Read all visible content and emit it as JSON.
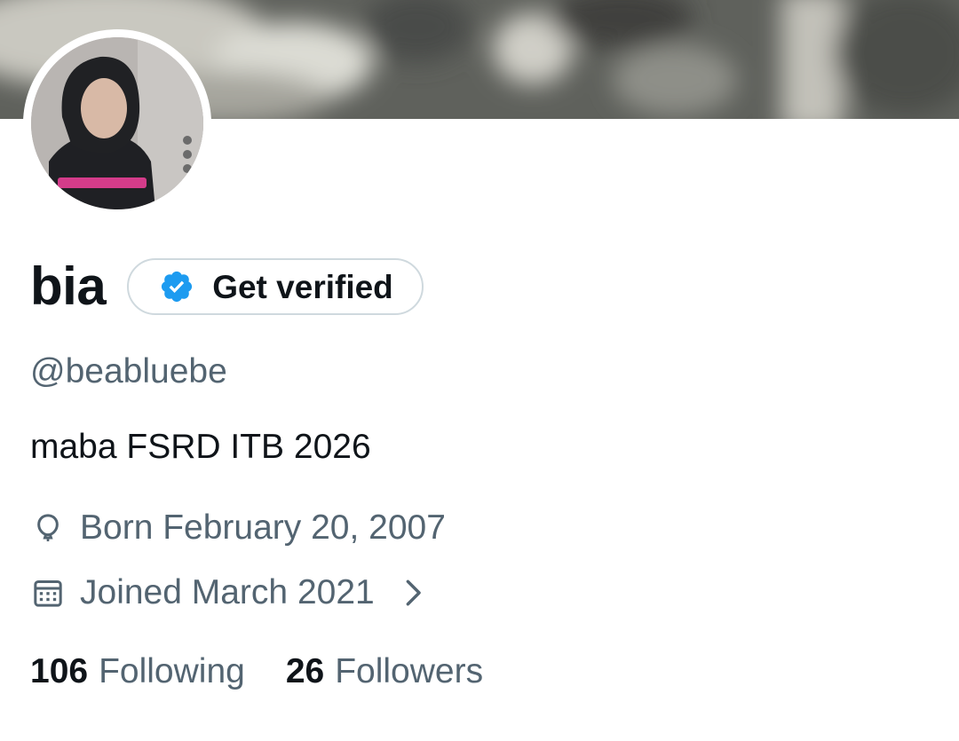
{
  "profile": {
    "display_name": "bia",
    "handle": "@beabluebe",
    "bio": "maba FSRD ITB 2026",
    "birthday": "Born February 20, 2007",
    "joined": "Joined March 2021"
  },
  "verify_button": {
    "label": "Get verified",
    "badge_color": "#1d9bf0"
  },
  "stats": {
    "following_count": "106",
    "following_label": "Following",
    "followers_count": "26",
    "followers_label": "Followers"
  },
  "icons": {
    "birthday": "balloon-icon",
    "joined": "calendar-icon",
    "joined_more": "chevron-right-icon",
    "verified": "verified-badge-icon"
  },
  "colors": {
    "primary_text": "#0f1419",
    "secondary_text": "#536471",
    "border": "#cfd9de"
  }
}
